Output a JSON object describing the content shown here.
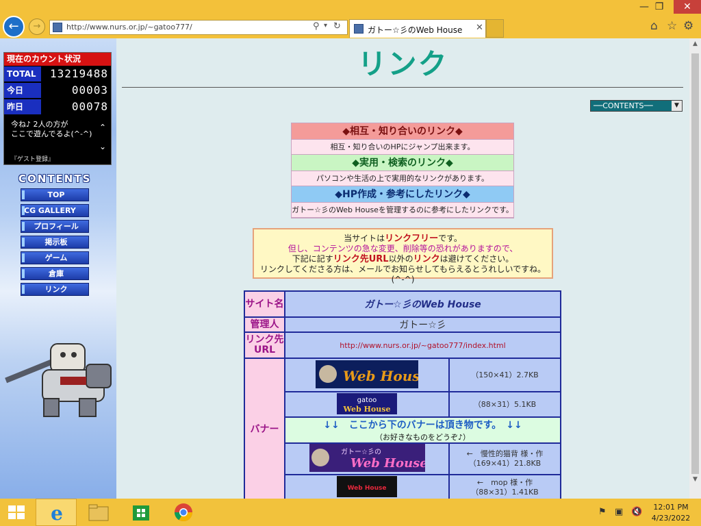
{
  "browser": {
    "window_controls": {
      "minimize": "—",
      "maximize": "❐",
      "close": "✕"
    },
    "back_glyph": "←",
    "forward_glyph": "→",
    "address": "http://www.nurs.or.jp/~gatoo777/",
    "tab_title": "ガトー☆彡のWeb House",
    "icons": [
      "home-icon",
      "star-icon",
      "gear-icon",
      "search-icon",
      "refresh-icon"
    ]
  },
  "counter": {
    "title": "現在のカウント状況",
    "rows": [
      {
        "label": "TOTAL",
        "value": "13219488"
      },
      {
        "label": "今日",
        "value": "00003"
      },
      {
        "label": "昨日",
        "value": "00078"
      }
    ],
    "message_line1": "今ね♪ 2人の方が",
    "message_line2": "ここで遊んでるよ(^-^)",
    "link": "『ゲスト登録』"
  },
  "nav": {
    "heading": "CONTENTS",
    "items": [
      "TOP",
      "CG GALLERY",
      "プロフィール",
      "掲示板",
      "ゲーム",
      "倉庫",
      "リンク"
    ]
  },
  "main": {
    "title": "リンク",
    "contents_select": "──CONTENTS──",
    "categories": [
      {
        "head": "◆相互・知り合いのリンク◆",
        "desc": "相互・知り合いのHPにジャンプ出来ます。"
      },
      {
        "head": "◆実用・検索のリンク◆",
        "desc": "パソコンや生活の上で実用的なリンクがあります。"
      },
      {
        "head": "◆HP作成・参考にしたリンク◆",
        "desc": "ガトー☆彡のWeb Houseを管理するのに参考にしたリンクです。"
      }
    ],
    "notice": {
      "l1_a": "当サイトは",
      "l1_b": "リンクフリー",
      "l1_c": "です。",
      "l2": "但し、コンテンツの急な変更、削除等の恐れがありますので、",
      "l3_a": "下記に記す",
      "l3_b": "リンク先URL",
      "l3_c": "以外の",
      "l3_d": "リンク",
      "l3_e": "は避けてください。",
      "l4": "リンクしてくださる方は、メールでお知らせしてもらえるとうれしいですね。(^-^)"
    },
    "info": {
      "site_label": "サイト名",
      "site_name": "ガトー☆彡のWeb House",
      "admin_label": "管理人",
      "admin_name": "ガトー☆彡",
      "url_label": "リンク先URL",
      "url": "http://www.nurs.or.jp/~gatoo777/index.html",
      "banner_label": "バナー",
      "banner1_size": "（150×41）2.7KB",
      "banner2_size": "（88×31）5.1KB",
      "banner2_text1": "gatoo",
      "banner2_text2": "Web House",
      "gift_main": "↓↓　ここから下のバナーは頂き物です。　↓↓",
      "gift_sub": "（お好きなものをどうぞ♪）",
      "banner3_credit": "←　慢性的猫背 様・作",
      "banner3_size": "（169×41）21.8KB",
      "banner4_credit": "←　mop 様・作",
      "banner4_size": "（88×31）1.41KB",
      "banner1_text": "Web House",
      "banner3_text1": "ガトー☆彡の",
      "banner3_text2": "Web House",
      "banner4_text": "Web House"
    }
  },
  "taskbar": {
    "time": "12:01 PM",
    "date": "4/23/2022"
  }
}
